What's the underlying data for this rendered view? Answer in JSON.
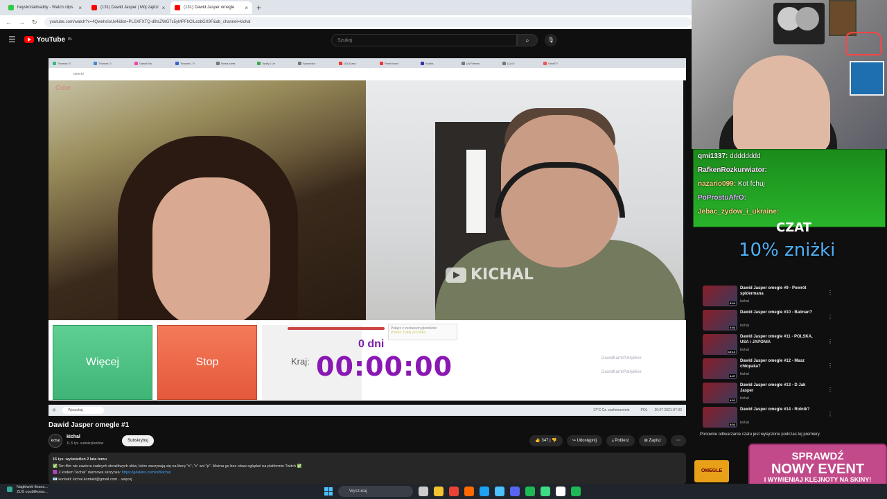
{
  "browser": {
    "tabs": [
      {
        "label": "heysircitalmaddy - Watch clips",
        "color": "#2ecc40"
      },
      {
        "label": "(131) Dawid Jasper | Mój zajdzi",
        "color": "#ff0000"
      },
      {
        "label": "(131) Dawid Jasper omegle",
        "color": "#ff0000"
      }
    ],
    "url": "youtube.com/watch?v=4QwehsIoUx4&list=PLSXFXTQ-d9tsZWG7c5yMPFhCILezbGX9F&ab_channel=kichal"
  },
  "youtube": {
    "logo": "YouTube",
    "region": "PL",
    "search_placeholder": "Szukaj"
  },
  "player": {
    "inner_tabs": [
      "Thomaz O",
      "Thomaz O",
      "Dawid Wo",
      "Tinamel | Tr",
      "Nowa karta",
      "Topify | Lin",
      "Sprawdza",
      "(10) Dawi",
      "Panel karol",
      "Kaldia -",
      "(4) Friends",
      "(1) Gr",
      "OmeTV"
    ],
    "inner_url": "ome.tv",
    "cam_mark": "Ome",
    "watermark": "KICHAL",
    "btn_more": "Więcej",
    "btn_stop": "Stop",
    "kraj": "Kraj:",
    "days": "0 dni",
    "timer": "00:00:00",
    "popup_line1": "Połącz z zestawem głośników",
    "popup_line2": "Polska. Dalej szczotka",
    "link1": "DawidKamilPatryklive",
    "link2": "DawidKamilPatryklive",
    "inner_search": "Wyszukaj",
    "inner_weather": "17°C Cz. zachmurzenie",
    "inner_lang": "POL",
    "inner_time": "20:07 2021-07-02"
  },
  "video": {
    "title": "Dawid Jasper omegle #1",
    "channel": "kichal",
    "subscribers": "11,5 tys. subskrybentów",
    "subscribe_label": "Subskrybuj",
    "likes": "347",
    "share_label": "Udostępnij",
    "download_label": "Pobierz",
    "save_label": "Zapisz",
    "desc_line1": "15 tys. wyświetleń  2 lata temu",
    "desc_line2": "✅ Ten film nie zawiera żadnych obraźliwych słów, które zaczynają się na literę \"n\", \"c\" ani \"p\". Można go bez obaw oglądać na platformie Twitch ✅",
    "desc_line3": "🟪 Z kodem \"kichal\" darmowa skrzynka: ",
    "desc_link": "https://g4skins.com/ref/kichal",
    "desc_line4": "📧 kontakt: kichal.kontakt@gmail.com ...więcej"
  },
  "chat": [
    {
      "user": "qmi1337:",
      "msg": "dddddddd",
      "cls": "u1"
    },
    {
      "user": "RafkenRozkurwiator:",
      "msg": "",
      "cls": "u2"
    },
    {
      "user": "nazario099:",
      "msg": "Kot fchuj",
      "cls": "u3"
    },
    {
      "user": "PoProstuAfrO:",
      "msg": "",
      "cls": "u4"
    },
    {
      "user": "Jebac_zydow_i_ukraine:",
      "msg": "",
      "cls": "u3"
    }
  ],
  "overlay": {
    "chat_label": "CZAT",
    "promo": "10% zniżki",
    "event_line1": "SPRAWDŹ",
    "event_line2": "NOWY EVENT",
    "event_line3": "I WYMIENIAJ KLEJNOTY NA SKINY!",
    "event_badge": "OMEGLE"
  },
  "suggested": [
    {
      "title": "Dawid Jasper omegle #9 - Powrót spidermana",
      "channel": "kichal",
      "dur": "9:24"
    },
    {
      "title": "Dawid Jasper omegle #10 - Batman?",
      "channel": "kichal",
      "dur": "6:52"
    },
    {
      "title": "Dawid Jasper omegle #11 - POLSKA, USA i JAPONIA",
      "channel": "kichal",
      "dur": "10:13"
    },
    {
      "title": "Dawid Jasper omegle #12 - Masz chłopaka?",
      "channel": "kichal",
      "dur": "4:47"
    },
    {
      "title": "Dawid Jasper omegle #13 - D Jak Jasper",
      "channel": "kichal",
      "dur": "4:31"
    },
    {
      "title": "Dawid Jasper omegle #14 - Rolnik?",
      "channel": "kichal",
      "dur": "5:02"
    }
  ],
  "replay_note": "Ponowne odtwarzanie czatu jest wyłączone podczas tej premiery.",
  "taskbar": {
    "notif_line1": "Nagłówek finans...",
    "notif_line2": "ZUS opublikowa...",
    "search": "Wyszukaj",
    "icons": [
      "#ccc",
      "#f4c430",
      "#ea4335",
      "#ff6a00",
      "#1da1f2",
      "#4cc2ff",
      "#5865f2",
      "#1db954",
      "#3ddc84",
      "#ffffff",
      "#1db954"
    ]
  }
}
